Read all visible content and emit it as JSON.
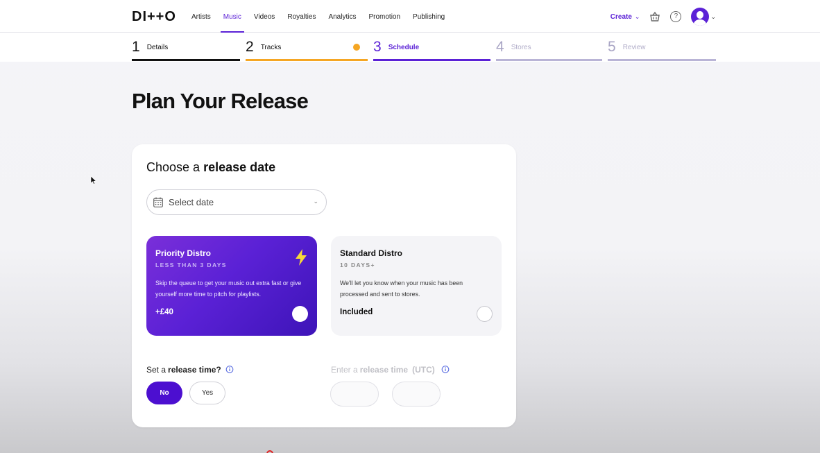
{
  "brand": {
    "logo": "DI++O"
  },
  "nav": {
    "links": [
      "Artists",
      "Music",
      "Videos",
      "Royalties",
      "Analytics",
      "Promotion",
      "Publishing"
    ],
    "active": "Music",
    "create_label": "Create"
  },
  "stepper": {
    "steps": [
      {
        "num": "1",
        "label": "Details",
        "state": "done",
        "bar_color": "#111111"
      },
      {
        "num": "2",
        "label": "Tracks",
        "state": "warning",
        "bar_color": "#f5a623"
      },
      {
        "num": "3",
        "label": "Schedule",
        "state": "active",
        "bar_color": "#5b21d6"
      },
      {
        "num": "4",
        "label": "Stores",
        "state": "upcoming",
        "bar_color": "#b9b4d6"
      },
      {
        "num": "5",
        "label": "Review",
        "state": "upcoming",
        "bar_color": "#b9b4d6"
      }
    ]
  },
  "page": {
    "title": "Plan Your Release"
  },
  "release_date": {
    "title_prefix": "Choose a",
    "title_bold": "release date",
    "placeholder": "Select date"
  },
  "options": {
    "priority": {
      "title": "Priority Distro",
      "subtitle": "LESS THAN 3 DAYS",
      "description": "Skip the queue to get your music out extra fast or give yourself more time to pitch for playlists.",
      "price": "+£40"
    },
    "standard": {
      "title": "Standard Distro",
      "subtitle": "10 DAYS+",
      "description": "We'll let you know when your music has been processed and sent to stores.",
      "price": "Included"
    }
  },
  "release_time": {
    "label_prefix": "Set a",
    "label_bold": "release time?",
    "no_label": "No",
    "yes_label": "Yes",
    "selected": "No"
  },
  "release_time_utc": {
    "label_prefix": "Enter a",
    "label_bold": "release time",
    "label_suffix": "(UTC)"
  },
  "colors": {
    "accent": "#5b21d6",
    "warning": "#f5a623",
    "button_active": "#4c0fd0"
  }
}
